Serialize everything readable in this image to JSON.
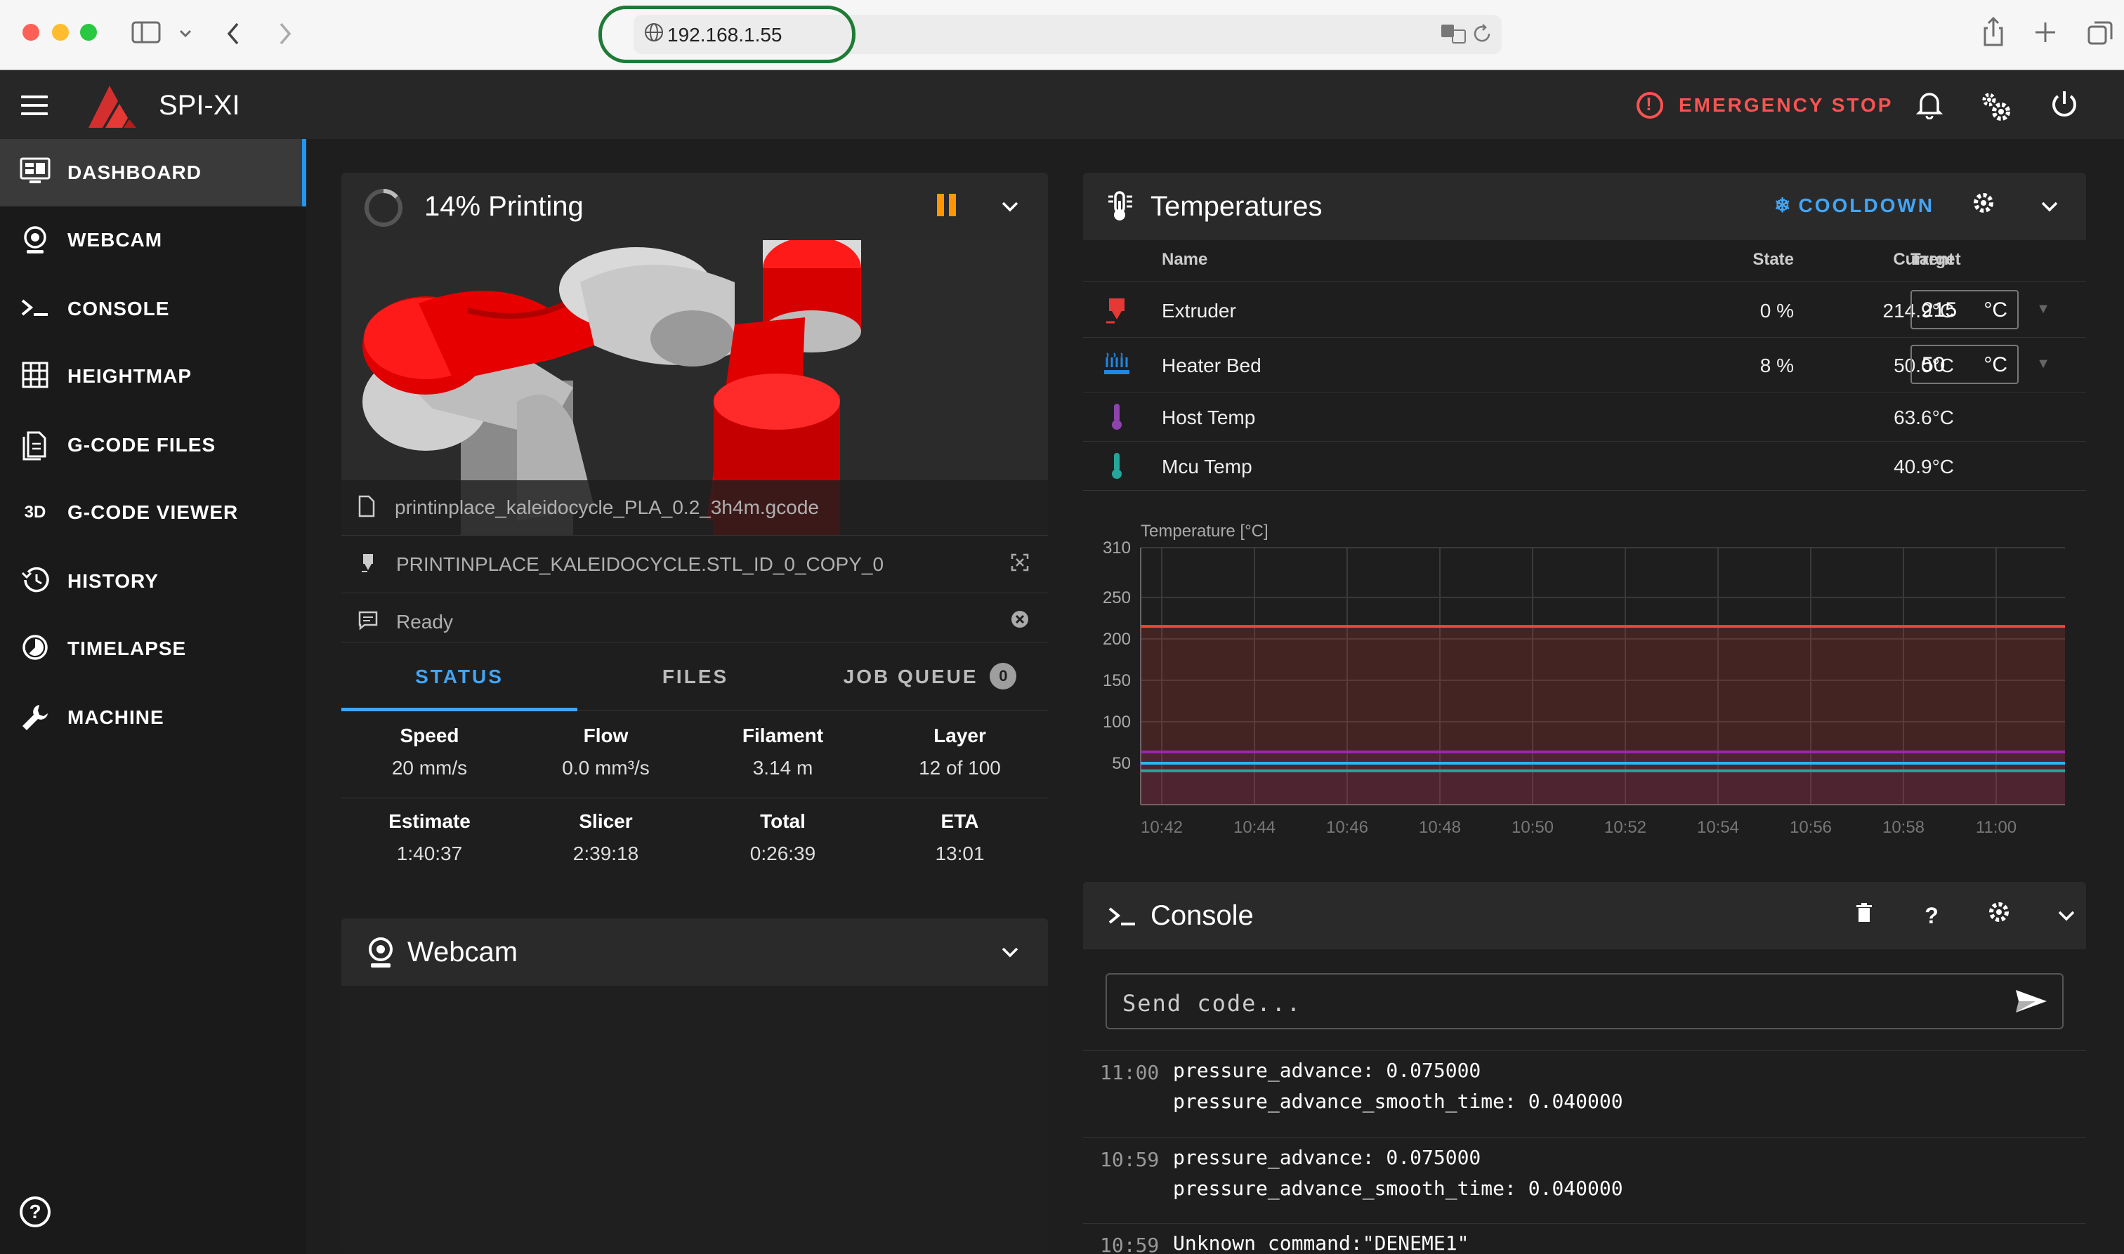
{
  "browser": {
    "url": "192.168.1.55"
  },
  "app": {
    "brand": "SPI-XI",
    "emergency_stop": "EMERGENCY STOP"
  },
  "sidebar": {
    "items": [
      {
        "label": "DASHBOARD",
        "icon": "monitor-dashboard-icon",
        "active": true
      },
      {
        "label": "WEBCAM",
        "icon": "webcam-icon"
      },
      {
        "label": "CONSOLE",
        "icon": "console-icon"
      },
      {
        "label": "HEIGHTMAP",
        "icon": "grid-icon"
      },
      {
        "label": "G-CODE FILES",
        "icon": "file-document-icon"
      },
      {
        "label": "G-CODE VIEWER",
        "icon": "3d-icon"
      },
      {
        "label": "HISTORY",
        "icon": "history-icon"
      },
      {
        "label": "TIMELAPSE",
        "icon": "timelapse-icon"
      },
      {
        "label": "MACHINE",
        "icon": "wrench-icon"
      }
    ]
  },
  "print": {
    "title": "14% Printing",
    "progress": 0.14,
    "filename": "printinplace_kaleidocycle_PLA_0.2_3h4m.gcode",
    "object": "PRINTINPLACE_KALEIDOCYCLE.STL_ID_0_COPY_0",
    "status_message": "Ready",
    "tabs": {
      "status": "STATUS",
      "files": "FILES",
      "job_queue": "JOB QUEUE",
      "job_queue_count": "0"
    },
    "stats": {
      "speed": {
        "label": "Speed",
        "value": "20 mm/s"
      },
      "flow": {
        "label": "Flow",
        "value": "0.0 mm³/s"
      },
      "filament": {
        "label": "Filament",
        "value": "3.14 m"
      },
      "layer": {
        "label": "Layer",
        "value": "12 of 100"
      },
      "estimate": {
        "label": "Estimate",
        "value": "1:40:37"
      },
      "slicer": {
        "label": "Slicer",
        "value": "2:39:18"
      },
      "total": {
        "label": "Total",
        "value": "0:26:39"
      },
      "eta": {
        "label": "ETA",
        "value": "13:01"
      }
    }
  },
  "webcam": {
    "title": "Webcam"
  },
  "temperatures": {
    "title": "Temperatures",
    "cooldown": "COOLDOWN",
    "headers": {
      "name": "Name",
      "state": "State",
      "current": "Current",
      "target": "Target"
    },
    "rows": [
      {
        "name": "Extruder",
        "state": "0 %",
        "current": "214.9°C",
        "target": "215",
        "unit": "°C",
        "color": "#e53935"
      },
      {
        "name": "Heater Bed",
        "state": "8 %",
        "current": "50.0°C",
        "target": "50",
        "unit": "°C",
        "color": "#1e88e5"
      },
      {
        "name": "Host Temp",
        "state": "",
        "current": "63.6°C",
        "color": "#8e44ad"
      },
      {
        "name": "Mcu Temp",
        "state": "",
        "current": "40.9°C",
        "color": "#26a69a"
      }
    ]
  },
  "chart_data": {
    "type": "line",
    "ylabel": "Temperature [°C]",
    "xlabel": "",
    "ylim": [
      0,
      310
    ],
    "yticks": [
      50,
      100,
      150,
      200,
      250,
      310
    ],
    "x": [
      "10:42",
      "10:44",
      "10:46",
      "10:48",
      "10:50",
      "10:52",
      "10:54",
      "10:56",
      "10:58",
      "11:00"
    ],
    "series": [
      {
        "values": [
          215,
          215,
          215,
          215,
          215,
          215,
          215,
          215,
          215,
          215
        ],
        "color": "#f44336"
      },
      {
        "values": [
          63.6,
          63.6,
          63.6,
          63.6,
          63.6,
          63.6,
          63.6,
          63.6,
          63.6,
          63.6
        ],
        "color": "#9c27b0"
      },
      {
        "values": [
          50,
          50,
          50,
          50,
          50,
          50,
          50,
          50,
          50,
          50
        ],
        "color": "#29b6f6"
      },
      {
        "values": [
          40.9,
          40.9,
          40.9,
          40.9,
          40.9,
          40.9,
          40.9,
          40.9,
          40.9,
          40.9
        ],
        "color": "#26a69a"
      }
    ],
    "grid": true
  },
  "console": {
    "title": "Console",
    "placeholder": "Send code...",
    "entries": [
      {
        "time": "11:00",
        "message": "pressure_advance: 0.075000\npressure_advance_smooth_time: 0.040000"
      },
      {
        "time": "10:59",
        "message": "pressure_advance: 0.075000\npressure_advance_smooth_time: 0.040000"
      },
      {
        "time": "10:59",
        "message": "Unknown command:\"DENEME1\""
      }
    ]
  }
}
